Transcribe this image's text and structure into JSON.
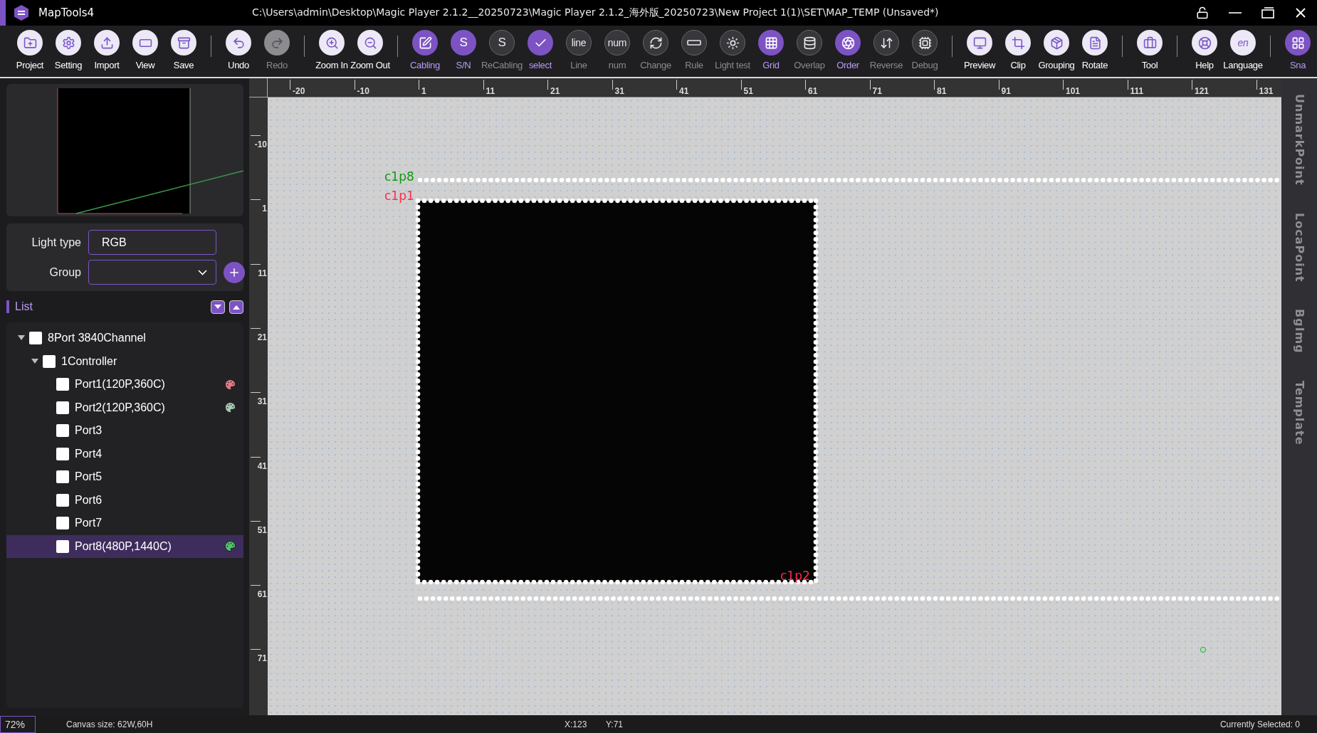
{
  "window": {
    "app_name": "MapTools4",
    "title": "C:\\Users\\admin\\Desktop\\Magic Player 2.1.2__20250723\\Magic Player 2.1.2_海外版_20250723\\New Project 1(1)\\SET\\MAP_TEMP (Unsaved*)"
  },
  "toolbar": [
    [
      {
        "label": "Project",
        "kind": "light"
      },
      {
        "label": "Setting",
        "kind": "light"
      },
      {
        "label": "Import",
        "kind": "light"
      },
      {
        "label": "View",
        "kind": "light"
      },
      {
        "label": "Save",
        "kind": "light"
      }
    ],
    [
      {
        "label": "Undo",
        "kind": "light"
      },
      {
        "label": "Redo",
        "kind": "disabled"
      }
    ],
    [
      {
        "label": "Zoom In",
        "kind": "light"
      },
      {
        "label": "Zoom Out",
        "kind": "light"
      }
    ],
    [
      {
        "label": "Cabling",
        "kind": "accent"
      },
      {
        "label": "S/N",
        "kind": "accent",
        "glyph": "S"
      },
      {
        "label": "ReCabling",
        "kind": "dim",
        "glyph": "S"
      },
      {
        "label": "select",
        "kind": "accent"
      },
      {
        "label": "Line",
        "kind": "dim",
        "glyph": "line"
      },
      {
        "label": "num",
        "kind": "dim",
        "glyph": "num"
      },
      {
        "label": "Change",
        "kind": "dim"
      },
      {
        "label": "Rule",
        "kind": "dim"
      },
      {
        "label": "Light test",
        "kind": "dim"
      },
      {
        "label": "Grid",
        "kind": "accent"
      },
      {
        "label": "Overlap",
        "kind": "dim"
      },
      {
        "label": "Order",
        "kind": "accent"
      },
      {
        "label": "Reverse",
        "kind": "dim"
      },
      {
        "label": "Debug",
        "kind": "dim"
      }
    ],
    [
      {
        "label": "Preview",
        "kind": "light"
      },
      {
        "label": "Clip",
        "kind": "light"
      },
      {
        "label": "Grouping",
        "kind": "light"
      },
      {
        "label": "Rotate",
        "kind": "light"
      }
    ],
    [
      {
        "label": "Tool",
        "kind": "light"
      }
    ],
    [
      {
        "label": "Help",
        "kind": "light"
      },
      {
        "label": "Language",
        "kind": "light",
        "glyph": "en"
      }
    ],
    [
      {
        "label": "Sna",
        "kind": "accent"
      }
    ]
  ],
  "properties": {
    "light_type_label": "Light type",
    "light_type": "RGB",
    "group_label": "Group"
  },
  "list": {
    "title": "List",
    "tree": [
      {
        "label": "8Port 3840Channel",
        "expanded": true,
        "checked": false,
        "selected": false,
        "children": [
          {
            "label": "1Controller",
            "expanded": true,
            "checked": false,
            "selected": false,
            "children": [
              {
                "label": "Port1(120P,360C)",
                "checked": false,
                "selected": false,
                "color": "#e07a86"
              },
              {
                "label": "Port2(120P,360C)",
                "checked": false,
                "selected": false,
                "color": "#a8c8b0"
              },
              {
                "label": "Port3",
                "checked": false,
                "selected": false
              },
              {
                "label": "Port4",
                "checked": false,
                "selected": false
              },
              {
                "label": "Port5",
                "checked": false,
                "selected": false
              },
              {
                "label": "Port6",
                "checked": false,
                "selected": false
              },
              {
                "label": "Port7",
                "checked": false,
                "selected": false
              },
              {
                "label": "Port8(480P,1440C)",
                "checked": false,
                "selected": true,
                "color": "#4fc46c"
              }
            ]
          }
        ]
      }
    ]
  },
  "ruler": {
    "x_labels": [
      "-20",
      "-10",
      "1",
      "11",
      "21",
      "31",
      "41",
      "51",
      "61",
      "71",
      "81",
      "91",
      "101",
      "111",
      "121",
      "131"
    ],
    "y_labels": [
      "-10",
      "1",
      "11",
      "21",
      "31",
      "41",
      "51",
      "61",
      "71"
    ]
  },
  "canvas": {
    "labels": [
      {
        "text": "c1p8",
        "color": "#0e9a0e"
      },
      {
        "text": "c1p1",
        "color": "#ff2a4a"
      },
      {
        "text": "c1p2",
        "color": "#ff2a4a"
      }
    ]
  },
  "side_tabs": [
    "UnmarkPoint",
    "LocaPoint",
    "BgImg",
    "Template"
  ],
  "status_bar": {
    "zoom": "72%",
    "canvas_size": "Canvas size:  62W,60H",
    "x": "X:123",
    "y": "Y:71",
    "selected": "Currently Selected: 0"
  }
}
